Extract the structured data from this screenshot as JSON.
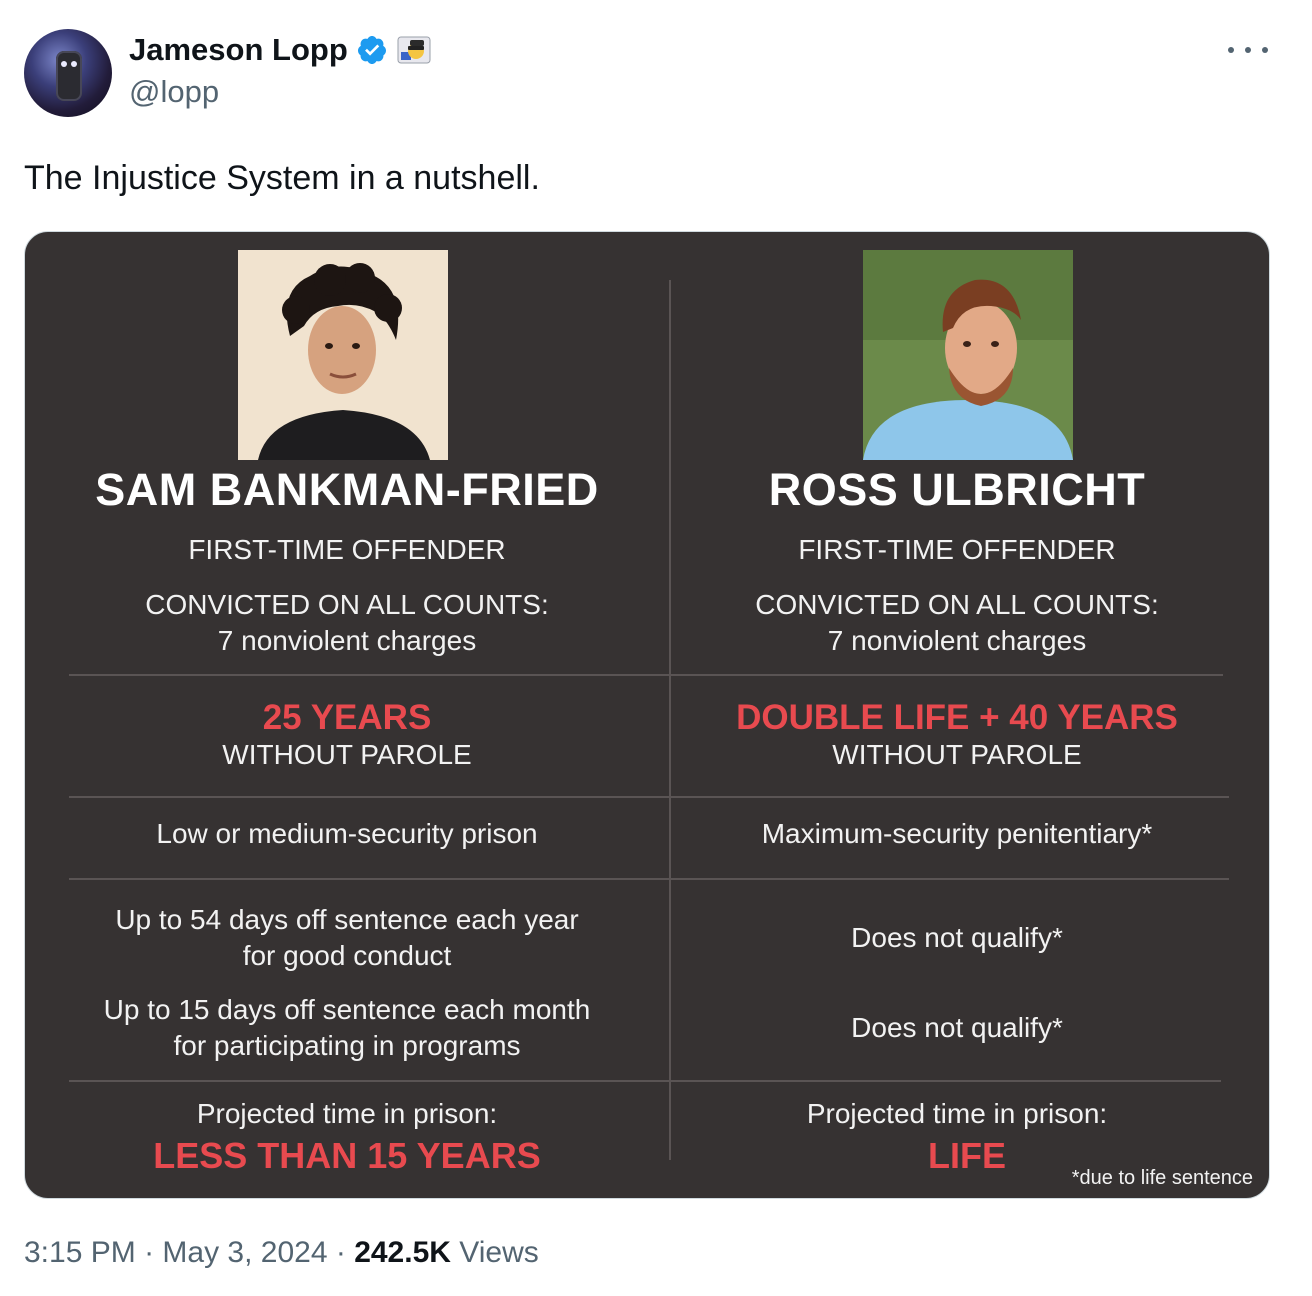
{
  "author": {
    "name": "Jameson Lopp",
    "handle": "@lopp"
  },
  "tweet": {
    "text": "The Injustice System in a nutshell."
  },
  "image": {
    "left": {
      "name": "SAM BANKMAN-FRIED",
      "offender": "FIRST-TIME OFFENDER",
      "convicted": "CONVICTED ON ALL COUNTS:",
      "charges": "7 nonviolent charges",
      "sentence": "25 YEARS",
      "parole": "WITHOUT PAROLE",
      "security": "Low or medium-security prison",
      "good_conduct_1": "Up to 54 days off sentence each year",
      "good_conduct_2": "for good conduct",
      "programs_1": "Up to 15 days off sentence each month",
      "programs_2": "for participating in programs",
      "projected_label": "Projected time in prison:",
      "projected_value": "LESS THAN 15 YEARS"
    },
    "right": {
      "name": "ROSS ULBRICHT",
      "offender": "FIRST-TIME OFFENDER",
      "convicted": "CONVICTED ON ALL COUNTS:",
      "charges": "7 nonviolent charges",
      "sentence": "DOUBLE LIFE + 40 YEARS",
      "parole": "WITHOUT PAROLE",
      "security": "Maximum-security penitentiary*",
      "good_conduct": "Does not qualify*",
      "programs": "Does not qualify*",
      "projected_label": "Projected time in prison:",
      "projected_value": "LIFE"
    },
    "footnote": "*due to life sentence"
  },
  "meta": {
    "time": "3:15 PM",
    "date": "May 3, 2024",
    "views_count": "242.5K",
    "views_label": "Views"
  },
  "colors": {
    "card_bg": "#363232",
    "accent_red": "#e84a4f",
    "verified_blue": "#1d9bf0",
    "muted": "#536471"
  }
}
